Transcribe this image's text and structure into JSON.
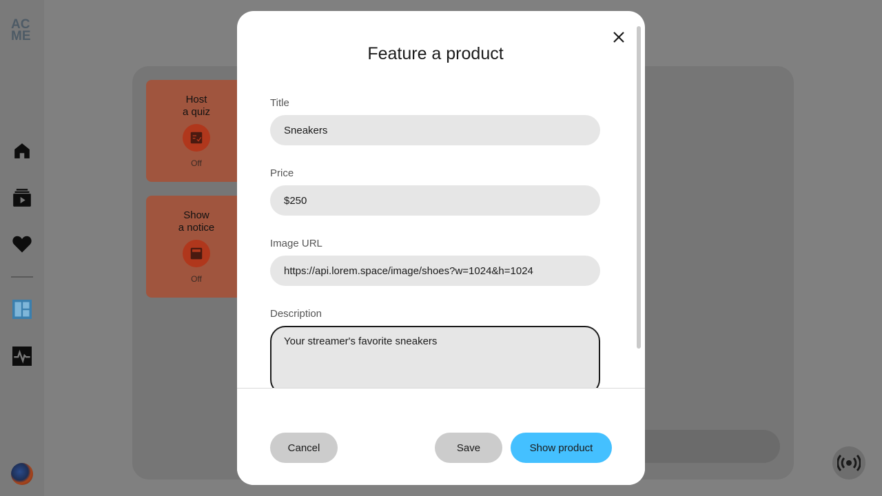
{
  "sidebar": {
    "logo_line1": "AC",
    "logo_line2": "ME",
    "icons": [
      "home-icon",
      "playlist-icon",
      "heart-icon",
      "dashboard-icon",
      "activity-icon"
    ]
  },
  "cards": [
    {
      "title": "Host\na quiz",
      "icon": "quiz-icon",
      "status": "Off"
    },
    {
      "title": "Show\na notice",
      "icon": "notice-icon",
      "status": "Off"
    }
  ],
  "modal": {
    "title": "Feature a product",
    "fields": {
      "title_label": "Title",
      "title_value": "Sneakers",
      "price_label": "Price",
      "price_value": "$250",
      "image_label": "Image URL",
      "image_value": "https://api.lorem.space/image/shoes?w=1024&h=1024",
      "description_label": "Description",
      "description_value": "Your streamer's favorite sneakers"
    },
    "buttons": {
      "cancel": "Cancel",
      "save": "Save",
      "show": "Show product"
    }
  },
  "colors": {
    "accent": "#44c0ff",
    "card": "#a0553e",
    "overlay": "#808080"
  }
}
